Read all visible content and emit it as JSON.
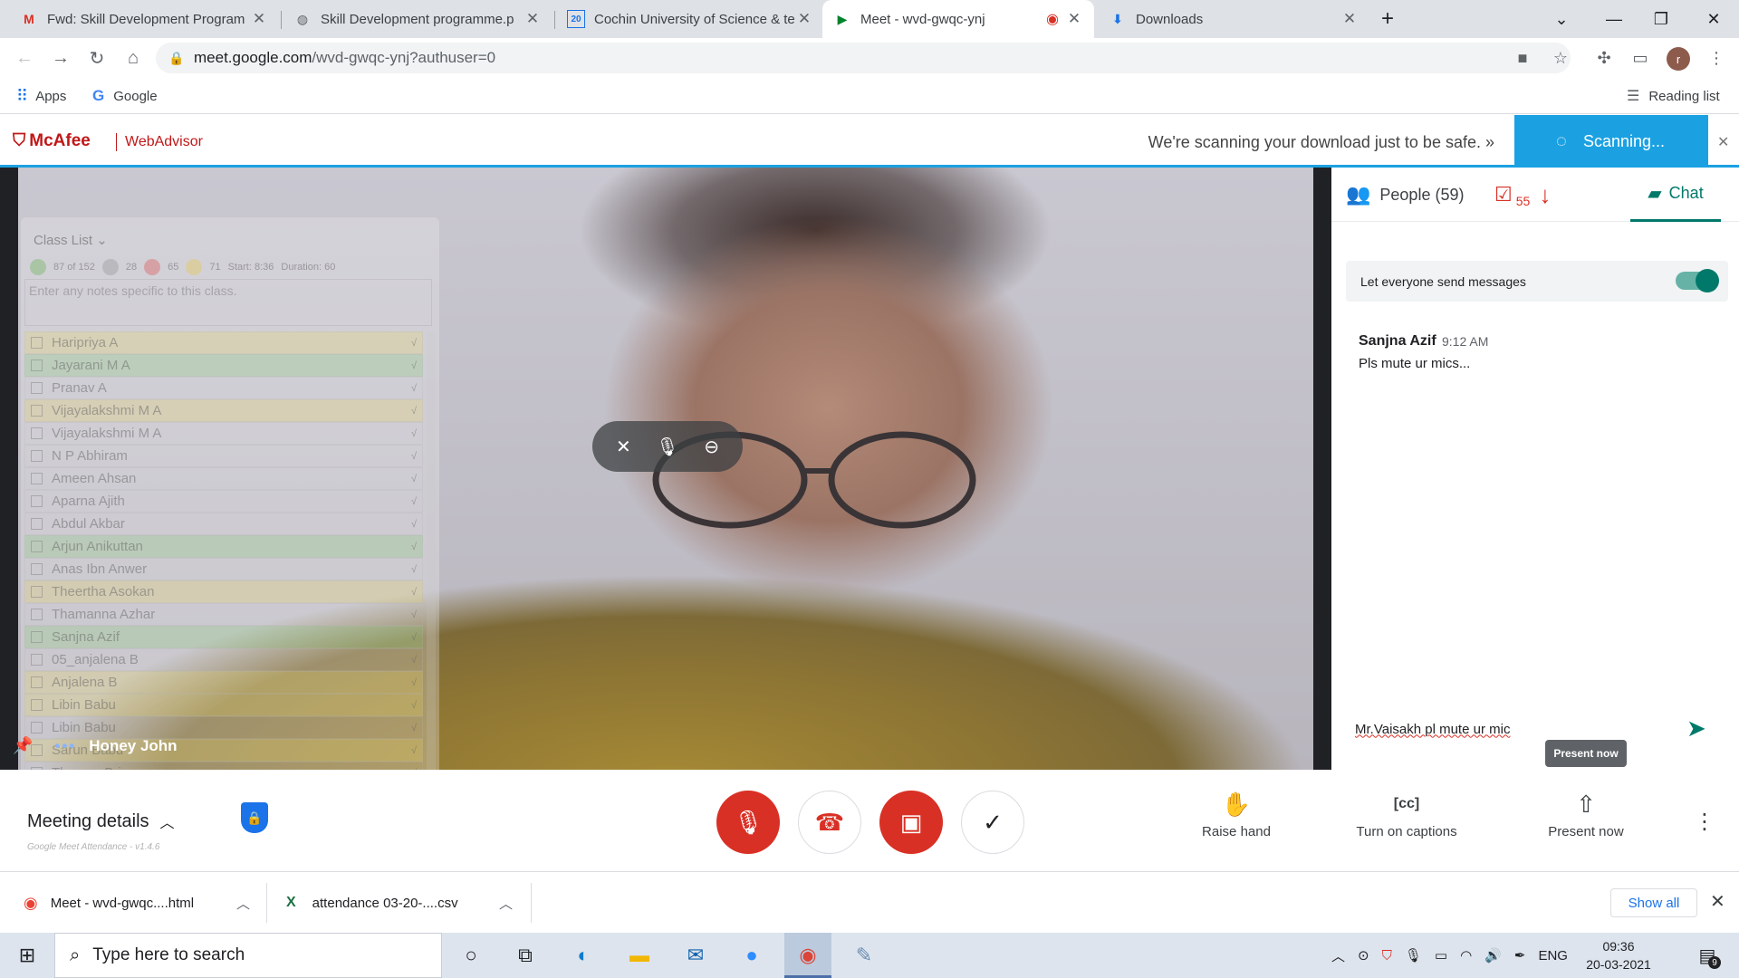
{
  "browser": {
    "tabs": [
      {
        "title": "Fwd: Skill Development Program",
        "favicon": "gmail-icon"
      },
      {
        "title": "Skill Development programme.p",
        "favicon": "globe-icon"
      },
      {
        "title": "Cochin University of Science & te",
        "favicon": "calendar-icon",
        "favicon_text": "20"
      },
      {
        "title": "Meet - wvd-gwqc-ynj",
        "favicon": "meet-icon",
        "active": true
      },
      {
        "title": "Downloads",
        "favicon": "download-icon"
      }
    ],
    "url_host": "meet.google.com",
    "url_path": "/wvd-gwqc-ynj?authuser=0",
    "profile_initial": "r",
    "bookmarks": [
      {
        "label": "Apps"
      },
      {
        "label": "Google"
      }
    ],
    "reading_list": "Reading list"
  },
  "mcafee": {
    "brand": "McAfee",
    "product": "WebAdvisor",
    "message": "We're scanning your download just to be safe. »",
    "status": "Scanning..."
  },
  "meet": {
    "speaker_name": "Honey John",
    "meeting_details": "Meeting details",
    "actions": {
      "raise_hand": "Raise hand",
      "captions": "Turn on captions",
      "present": "Present now"
    },
    "tooltip": "Present now",
    "panel": {
      "people_label": "People (59)",
      "attendance_count": "55",
      "chat_label": "Chat",
      "toggle_label": "Let everyone send messages",
      "messages": [
        {
          "sender": "Sanjna Azif",
          "time": "9:12 AM",
          "text": "Pls mute ur mics..."
        }
      ],
      "draft": "Mr.Vaisakh pl mute ur mic"
    }
  },
  "classlist": {
    "title": "Class List",
    "stats": [
      "87 of 152",
      "28",
      "65",
      "71",
      "Start: 8:36",
      "Duration: 60"
    ],
    "notes_placeholder": "Enter any notes specific to this class.",
    "students": [
      {
        "name": "Haripriya A",
        "state": "on"
      },
      {
        "name": "Jayarani M A",
        "state": "green"
      },
      {
        "name": "Pranav A",
        "state": "off"
      },
      {
        "name": "Vijayalakshmi M A",
        "state": "on"
      },
      {
        "name": "Vijayalakshmi M A",
        "state": "off"
      },
      {
        "name": "N P Abhiram",
        "state": "off"
      },
      {
        "name": "Ameen Ahsan",
        "state": "off"
      },
      {
        "name": "Aparna Ajith",
        "state": "off"
      },
      {
        "name": "Abdul Akbar",
        "state": "off"
      },
      {
        "name": "Arjun Anikuttan",
        "state": "green"
      },
      {
        "name": "Anas Ibn Anwer",
        "state": "off"
      },
      {
        "name": "Theertha Asokan",
        "state": "on"
      },
      {
        "name": "Thamanna Azhar",
        "state": "off"
      },
      {
        "name": "Sanjna Azif",
        "state": "green"
      },
      {
        "name": "05_anjalena B",
        "state": "off"
      },
      {
        "name": "Anjalena B",
        "state": "on"
      },
      {
        "name": "Libin Babu",
        "state": "on"
      },
      {
        "name": "Libin Babu",
        "state": "off"
      },
      {
        "name": "Sarun Babu",
        "state": "on"
      },
      {
        "name": "Thomas Brian",
        "state": "off"
      }
    ],
    "footer": "Google Meet Attendance - v1.4.6"
  },
  "downloads": [
    {
      "name": "Meet - wvd-gwqc....html",
      "icon": "chrome-icon"
    },
    {
      "name": "attendance 03-20-....csv",
      "icon": "excel-icon"
    }
  ],
  "downloads_show_all": "Show all",
  "taskbar": {
    "search_placeholder": "Type here to search",
    "lang": "ENG",
    "time": "09:36",
    "date": "20-03-2021",
    "notifications": "9"
  },
  "colors": {
    "meet_red": "#d93025",
    "meet_teal": "#00796b",
    "mcafee_red": "#c01818",
    "mcafee_blue": "#1ba1e2"
  }
}
